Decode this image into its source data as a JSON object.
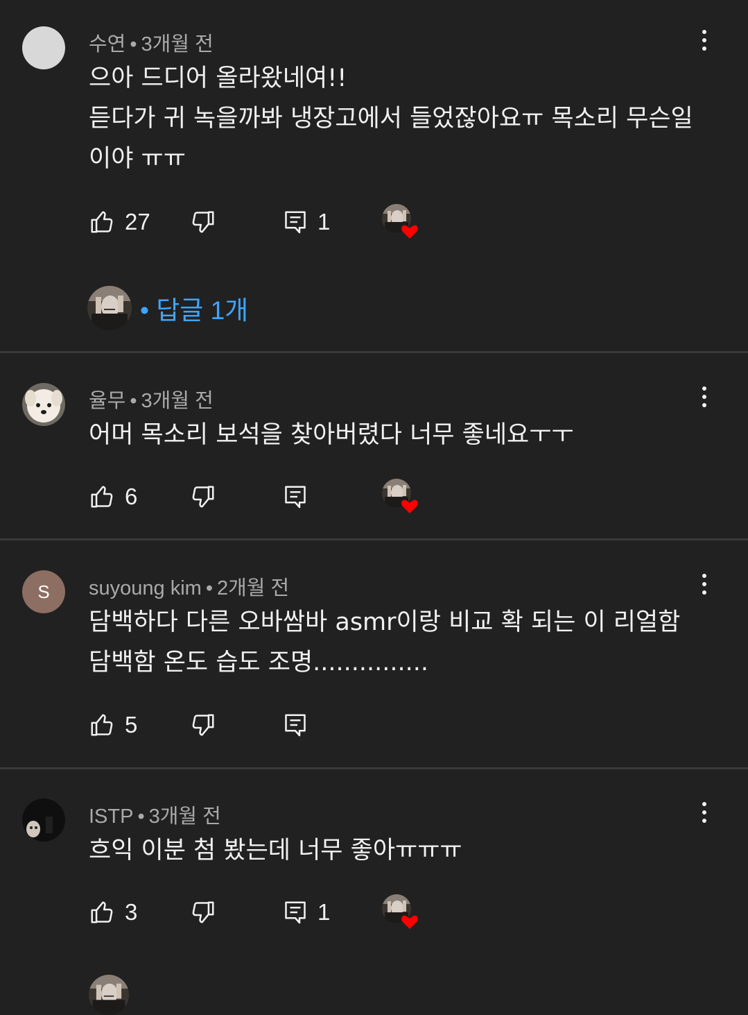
{
  "comments": [
    {
      "author": "수연",
      "sep": "•",
      "time": "3개월 전",
      "text": "으아 드디어 올라왔네여!!\n듣다가 귀 녹을까봐 냉장고에서 들었잖아요ㅠ 목소리 무슨일이야 ㅠㅠ",
      "likes": "27",
      "replies_count": "1",
      "creator_heart": true,
      "replies_label": "• 답글 1개"
    },
    {
      "author": "율무",
      "sep": "•",
      "time": "3개월 전",
      "text": "어머 목소리 보석을 찾아버렸다 너무 좋네요ㅜㅜ",
      "likes": "6",
      "replies_count": "",
      "creator_heart": true
    },
    {
      "author": "suyoung kim",
      "sep": "•",
      "time": "2개월 전",
      "avatar_letter": "S",
      "text": "담백하다 다른 오바쌈바 asmr이랑 비교 확 되는 이 리얼함 담백함 온도 습도 조명...............",
      "likes": "5",
      "replies_count": "",
      "creator_heart": false
    },
    {
      "author": "ISTP",
      "sep": "•",
      "time": "3개월 전",
      "text": "흐익 이분 첨 봤는데 너무 좋아ㅠㅠㅠ",
      "likes": "3",
      "replies_count": "1",
      "creator_heart": true
    }
  ],
  "icons": {
    "like": "thumbs-up-icon",
    "dislike": "thumbs-down-icon",
    "reply": "comment-icon",
    "more": "more-vertical-icon",
    "heart": "heart-icon"
  },
  "colors": {
    "background": "#212121",
    "link": "#3ea6ff",
    "heart": "#ff0000",
    "meta": "#aaaaaa"
  }
}
